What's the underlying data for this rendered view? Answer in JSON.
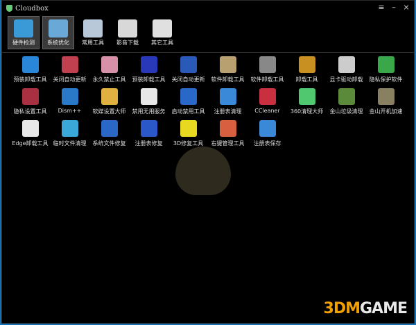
{
  "title": "Cloudbox",
  "window_controls": {
    "menu": "≡",
    "minimize": "–",
    "close": "×"
  },
  "toolbar": [
    {
      "label": "硬件检测",
      "color": "#3a9ad8",
      "selected": true
    },
    {
      "label": "系统优化",
      "color": "#6aa8d8",
      "selected": true
    },
    {
      "label": "常用工具",
      "color": "#b8c8d8",
      "selected": false
    },
    {
      "label": "影音下载",
      "color": "#d8d8d8",
      "selected": false
    },
    {
      "label": "其它工具",
      "color": "#e0e0e0",
      "selected": false
    }
  ],
  "tools": [
    {
      "label": "预装卸载工具",
      "color": "#2a86d8"
    },
    {
      "label": "关闭自动更新",
      "color": "#c04050"
    },
    {
      "label": "永久禁止工具",
      "color": "#d890a8"
    },
    {
      "label": "预装卸载工具",
      "color": "#2838b8"
    },
    {
      "label": "关闭自动更新",
      "color": "#2a5ab8"
    },
    {
      "label": "软件卸载工具",
      "color": "#b8a070"
    },
    {
      "label": "软件卸载工具",
      "color": "#888888"
    },
    {
      "label": "卸载工具",
      "color": "#c89020"
    },
    {
      "label": "显卡驱动卸载",
      "color": "#cccccc"
    },
    {
      "label": "隐私保护软件",
      "color": "#3aa84a"
    },
    {
      "label": "隐私设置工具",
      "color": "#a83040"
    },
    {
      "label": "Dism++",
      "color": "#2a78c8"
    },
    {
      "label": "软媒设置大师",
      "color": "#e0b040"
    },
    {
      "label": "禁用无用服务",
      "color": "#e8e8e8"
    },
    {
      "label": "启动禁用工具",
      "color": "#2a68c8"
    },
    {
      "label": "注册表清理",
      "color": "#3a88d8"
    },
    {
      "label": "CCleaner",
      "color": "#c83040"
    },
    {
      "label": "360清理大师",
      "color": "#50c870"
    },
    {
      "label": "金山垃圾清理",
      "color": "#5a8a3a"
    },
    {
      "label": "金山开机加速",
      "color": "#888060"
    },
    {
      "label": "Edge卸载工具",
      "color": "#e8e8e8"
    },
    {
      "label": "临时文件清理",
      "color": "#3aa8d8"
    },
    {
      "label": "系统文件修复",
      "color": "#2a68c8"
    },
    {
      "label": "注册表修复",
      "color": "#2a58c8"
    },
    {
      "label": "3D修复工具",
      "color": "#e8d820"
    },
    {
      "label": "右键管理工具",
      "color": "#d86040"
    },
    {
      "label": "注册表保存",
      "color": "#3a88d8"
    }
  ],
  "watermark": {
    "prefix": "3DM",
    "suffix": "GAME"
  }
}
